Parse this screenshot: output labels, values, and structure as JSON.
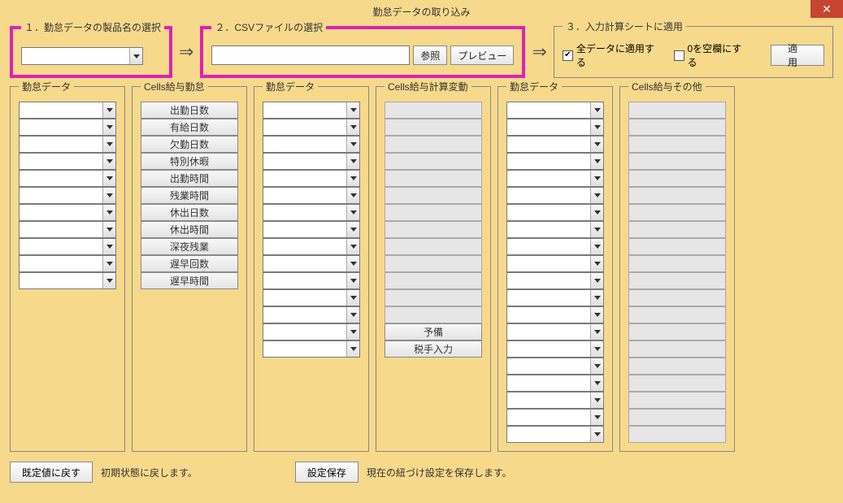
{
  "window": {
    "title": "勤怠データの取り込み"
  },
  "close": {
    "symbol": "✕"
  },
  "step1": {
    "legend": "１．勤怠データの製品名の選択"
  },
  "step2": {
    "legend": "２．CSVファイルの選択",
    "browse": "参照",
    "preview": "プレビュー"
  },
  "step3": {
    "legend": "３．入力計算シートに適用",
    "apply_all": "全データに適用する",
    "zero_blank": "0を空欄にする",
    "apply": "適用"
  },
  "cols": {
    "kintai1": "勤怠データ",
    "cells_kintai": "Cells給与勤怠",
    "kintai2": "勤怠データ",
    "cells_hendo": "Cells給与計算変動",
    "kintai3": "勤怠データ",
    "cells_other": "Cells給与その他"
  },
  "cells_kintai_items": [
    "出勤日数",
    "有給日数",
    "欠勤日数",
    "特別休暇",
    "出勤時間",
    "残業時間",
    "休出日数",
    "休出時間",
    "深夜残業",
    "遅早回数",
    "遅早時間"
  ],
  "hendo_extra": {
    "yobi": "予備",
    "zei": "税手入力"
  },
  "counts": {
    "kintai1_dd": 11,
    "kintai2_dd": 15,
    "hendo_grey": 13,
    "kintai3_dd": 20,
    "other_grey": 20
  },
  "bottom": {
    "reset": "既定値に戻す",
    "reset_text": "初期状態に戻します。",
    "save": "設定保存",
    "save_text": "現在の紐づけ設定を保存します。"
  }
}
